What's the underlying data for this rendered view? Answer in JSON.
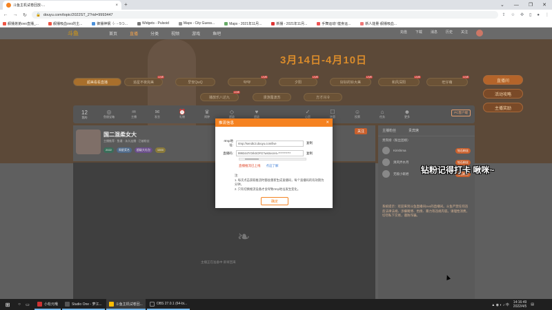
{
  "browser": {
    "tab_title": "斗鱼主机试卷回放-…",
    "url": "douyu.com/topic/2022ST_2?rid=9993447",
    "bookmarks": [
      "舰播弟弟ovo直播_...",
      "舰播吸血ovo的主...",
      "御播神钢（- ·- 5つ...",
      "Widgets - Pulsoid",
      "Maps - City Guess...",
      "Maps - 2021年11月...",
      "新播 - 2021年11月...",
      "手舞运动! 健身运...",
      "新人能量·舰播吸血..."
    ]
  },
  "site": {
    "logo": "斗鱼",
    "nav": [
      "首页",
      "直播",
      "分类",
      "视频",
      "游戏",
      "鱼吧"
    ],
    "header_right": [
      "充值",
      "下载",
      "消息",
      "历史",
      "关注"
    ],
    "banner_title": "3月14日-4月10日",
    "category_pills": [
      {
        "label": "超美看看直播",
        "active": true
      },
      {
        "label": "追星不夜完美"
      },
      {
        "label": "早安QwQ"
      },
      {
        "label": "qyqy"
      },
      {
        "label": "夕阳"
      },
      {
        "label": "好好的铃大美"
      },
      {
        "label": "和风深阳"
      },
      {
        "label": "旺仔萌"
      },
      {
        "label": "播放乐八达九"
      },
      {
        "label": "漫游露波苏"
      },
      {
        "label": "方才冷冷"
      }
    ],
    "side_pills": [
      "直播间",
      "活动攻略",
      "主播奖励"
    ],
    "toolbar": {
      "count": "12",
      "count_label": "我的",
      "items": [
        "鱼翅宝箱",
        "主播",
        "发言",
        "礼物",
        "闹钟",
        "超级",
        "超级",
        "心愿",
        "许愿",
        "投票",
        "任务",
        "更多"
      ],
      "pc_button": "PC客户端"
    },
    "streamer": {
      "name": "国二混柔女大",
      "meta": "主播推荐 · 鱼塘 · 永久连播 · 已被粉丝",
      "tags": [
        "2022",
        "周星奖名",
        "超级大礼包",
        "1000"
      ],
      "follow": "关注"
    },
    "video_hint": "主播正在准备中       即将回来",
    "chat": {
      "tabs": [
        "主播粉丝",
        "贵宾席"
      ],
      "rows": [
        {
          "name": "贵宾榜（粉丝团榜）",
          "badge": ""
        },
        {
          "name": "Kirishima",
          "badge": "钻石粉丝"
        },
        {
          "name": "清风弄水月",
          "badge": "钻石粉丝"
        },
        {
          "name": "无敌小碗君",
          "badge": "钻石粉丝"
        }
      ],
      "notice": "系统提示：欢迎来到斗鱼直播间ovo的直播间。斗鱼严禁任何违反法律法规、涉嫌赌博、色情、暴力等违规内容。请理性消费，切勿私下交易，谨防诈骗。"
    },
    "overlay_text": "钻粉记得打卡 啾咪~"
  },
  "modal": {
    "title": "推流信息",
    "rtmp_label": "rtmp地址:",
    "rtmp_value": "rtmp://sendtc3.douyu.com/live",
    "code_label": "直播码:",
    "code_value": "9993447rOrkSOFG?wsSecret=***********",
    "copy": "复制",
    "warning": "直播推流已上线",
    "learn_more": "点这了解",
    "notes_title": "注:",
    "notes": [
      "1. 每次点击获取推流时都会重新生成直播码，每个直播码的有效期为分钟。",
      "2. 只有切换推流设备才会导致rtmp地址发生变化。"
    ],
    "ok": "确定"
  },
  "taskbar": {
    "apps": [
      "小松元哦",
      "Studio One - 萝江...",
      "斗鱼主机试卷回...",
      "OBS 27.0.1 (64-bi..."
    ],
    "time": "14:16:49",
    "date": "2022/4/5"
  }
}
